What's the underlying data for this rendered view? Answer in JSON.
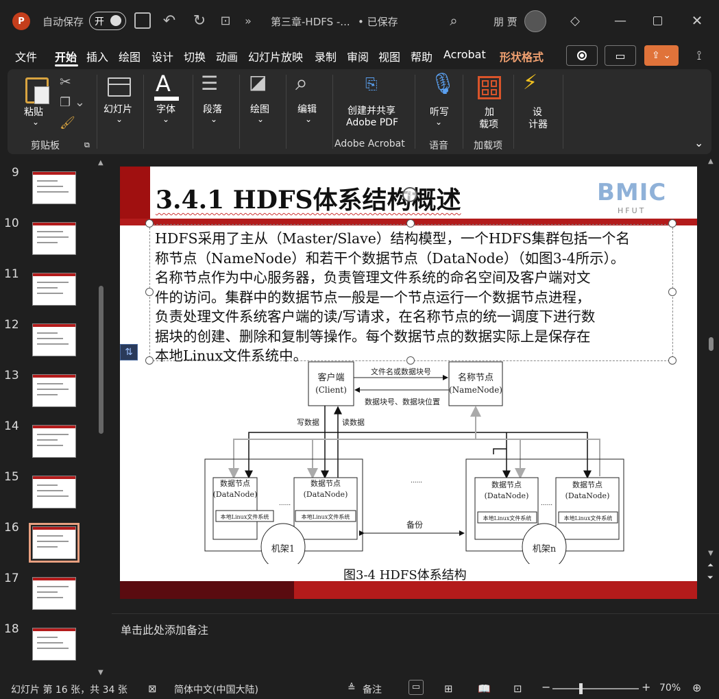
{
  "titlebar": {
    "autosave_label": "自动保存",
    "autosave_toggle": "开",
    "doc_title": "第三章-HDFS -...",
    "saved_status": "• 已保存",
    "user_name": "朋 贾"
  },
  "menu": {
    "tabs": [
      "文件",
      "开始",
      "插入",
      "绘图",
      "设计",
      "切换",
      "动画",
      "幻灯片放映",
      "录制",
      "审阅",
      "视图",
      "帮助",
      "Acrobat",
      "形状格式"
    ],
    "active": "开始"
  },
  "ribbon": {
    "paste": "粘贴",
    "clipboard_group": "剪贴板",
    "slides": "幻灯片",
    "font": "字体",
    "paragraph": "段落",
    "drawing": "绘图",
    "editing": "编辑",
    "create_share_1": "创建并共享",
    "create_share_2": "Adobe PDF",
    "adobe_group": "Adobe Acrobat",
    "dictate": "听写",
    "voice_group": "语音",
    "addins_1": "加",
    "addins_2": "载项",
    "addins_group": "加载项",
    "designer_1": "设",
    "designer_2": "计器"
  },
  "thumbnails": [
    {
      "num": "9"
    },
    {
      "num": "10"
    },
    {
      "num": "11"
    },
    {
      "num": "12"
    },
    {
      "num": "13"
    },
    {
      "num": "14"
    },
    {
      "num": "15"
    },
    {
      "num": "16"
    },
    {
      "num": "17"
    },
    {
      "num": "18"
    }
  ],
  "slide": {
    "title": "3.4.1 HDFS体系结构概述",
    "logo_text": "BMIC",
    "logo_sub": "HFUT",
    "body_lines": [
      "HDFS采用了主从（Master/Slave）结构模型，一个HDFS集群包括一个名",
      "称节点（NameNode）和若干个数据节点（DataNode）（如图3-4所示）。",
      "名称节点作为中心服务器，负责管理文件系统的命名空间及客户端对文",
      "件的访问。集群中的数据节点一般是一个节点运行一个数据节点进程，",
      "负责处理文件系统客户端的读/写请求，在名称节点的统一调度下进行数",
      "据块的创建、删除和复制等操作。每个数据节点的数据实际上是保存在",
      "本地Linux文件系统中。"
    ],
    "diagram": {
      "client_1": "客户端",
      "client_2": "(Client)",
      "namenode_1": "名称节点",
      "namenode_2": "(NameNode)",
      "edge_top": "文件名或数据块号",
      "edge_bottom": "数据块号、数据块位置",
      "write": "写数据",
      "read": "读数据",
      "datanode_1": "数据节点",
      "datanode_2": "(DataNode)",
      "local_fs": "本地Linux文件系统",
      "rack1": "机架1",
      "rackn": "机架n",
      "backup": "备份",
      "dots": "......",
      "caption": "图3-4 HDFS体系结构"
    }
  },
  "notes_placeholder": "单击此处添加备注",
  "status": {
    "slide_info": "幻灯片 第 16 张，共 34 张",
    "language": "简体中文(中国大陆)",
    "notes_btn": "备注",
    "zoom": "70%"
  },
  "colors": {
    "accent_red": "#b31b1b",
    "dark_red": "#5a0b10",
    "shape_format": "#f0a070",
    "share_btn": "#e0733a"
  }
}
